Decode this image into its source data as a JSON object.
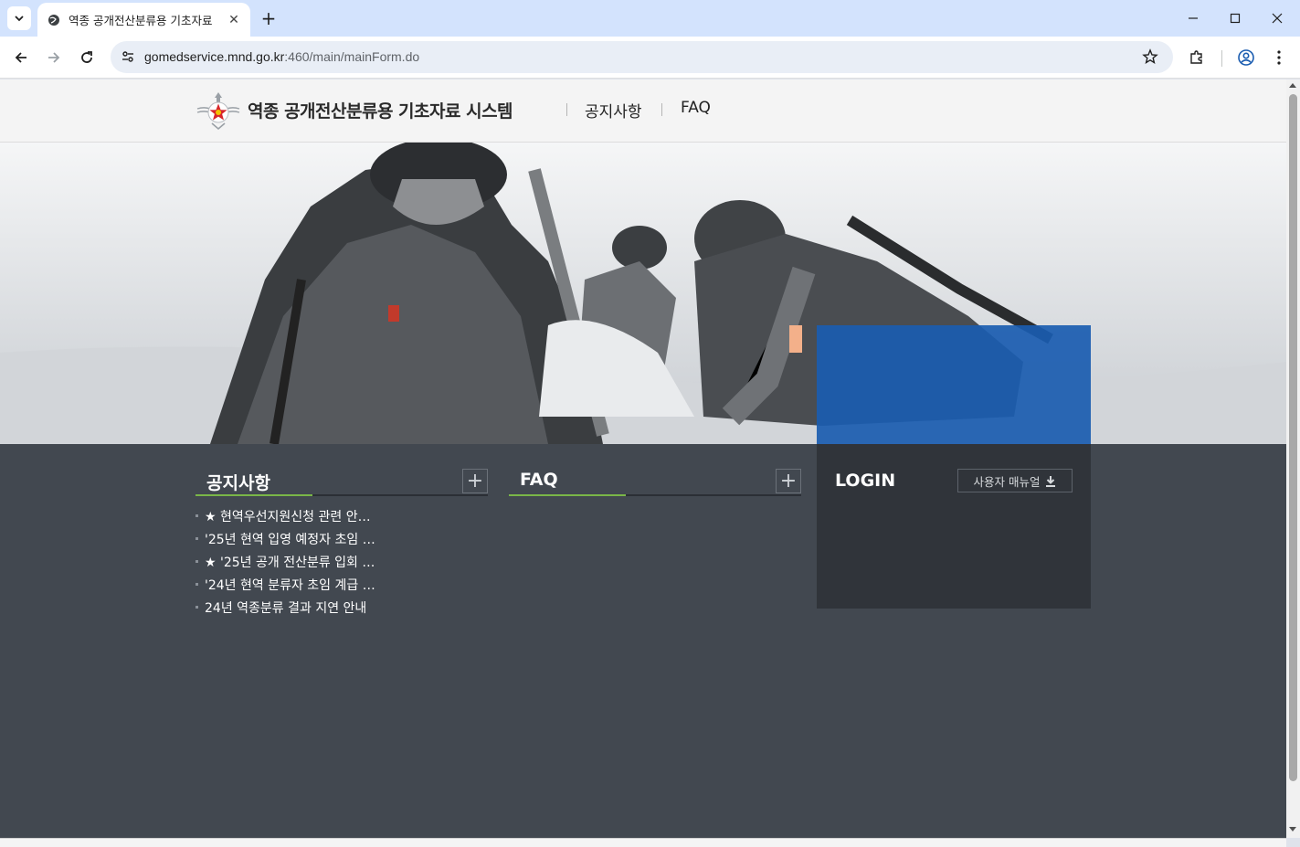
{
  "browser": {
    "tab_title": "역종 공개전산분류용 기초자료",
    "url_host": "gomedservice.mnd.go.kr",
    "url_rest": ":460/main/mainForm.do"
  },
  "site": {
    "title": "역종 공개전산분류용 기초자료 시스템",
    "nav": [
      "공지사항",
      "FAQ"
    ]
  },
  "notice": {
    "title": "공지사항",
    "more": "+",
    "items": [
      "★ 현역우선지원신청 관련 안…",
      "'25년 현역 입영 예정자 초임 …",
      "★ '25년 공개 전산분류 입회 …",
      "'24년 현역 분류자 초임 계급 …",
      "24년 역종분류 결과 지연 안내"
    ]
  },
  "faq": {
    "title": "FAQ",
    "more": "+"
  },
  "login": {
    "title": "LOGIN",
    "manual_label": "사용자 매뉴얼"
  },
  "colors": {
    "accent_green": "#7ab648",
    "login_blue": "#1a5cb0",
    "content_bg": "#424850"
  }
}
